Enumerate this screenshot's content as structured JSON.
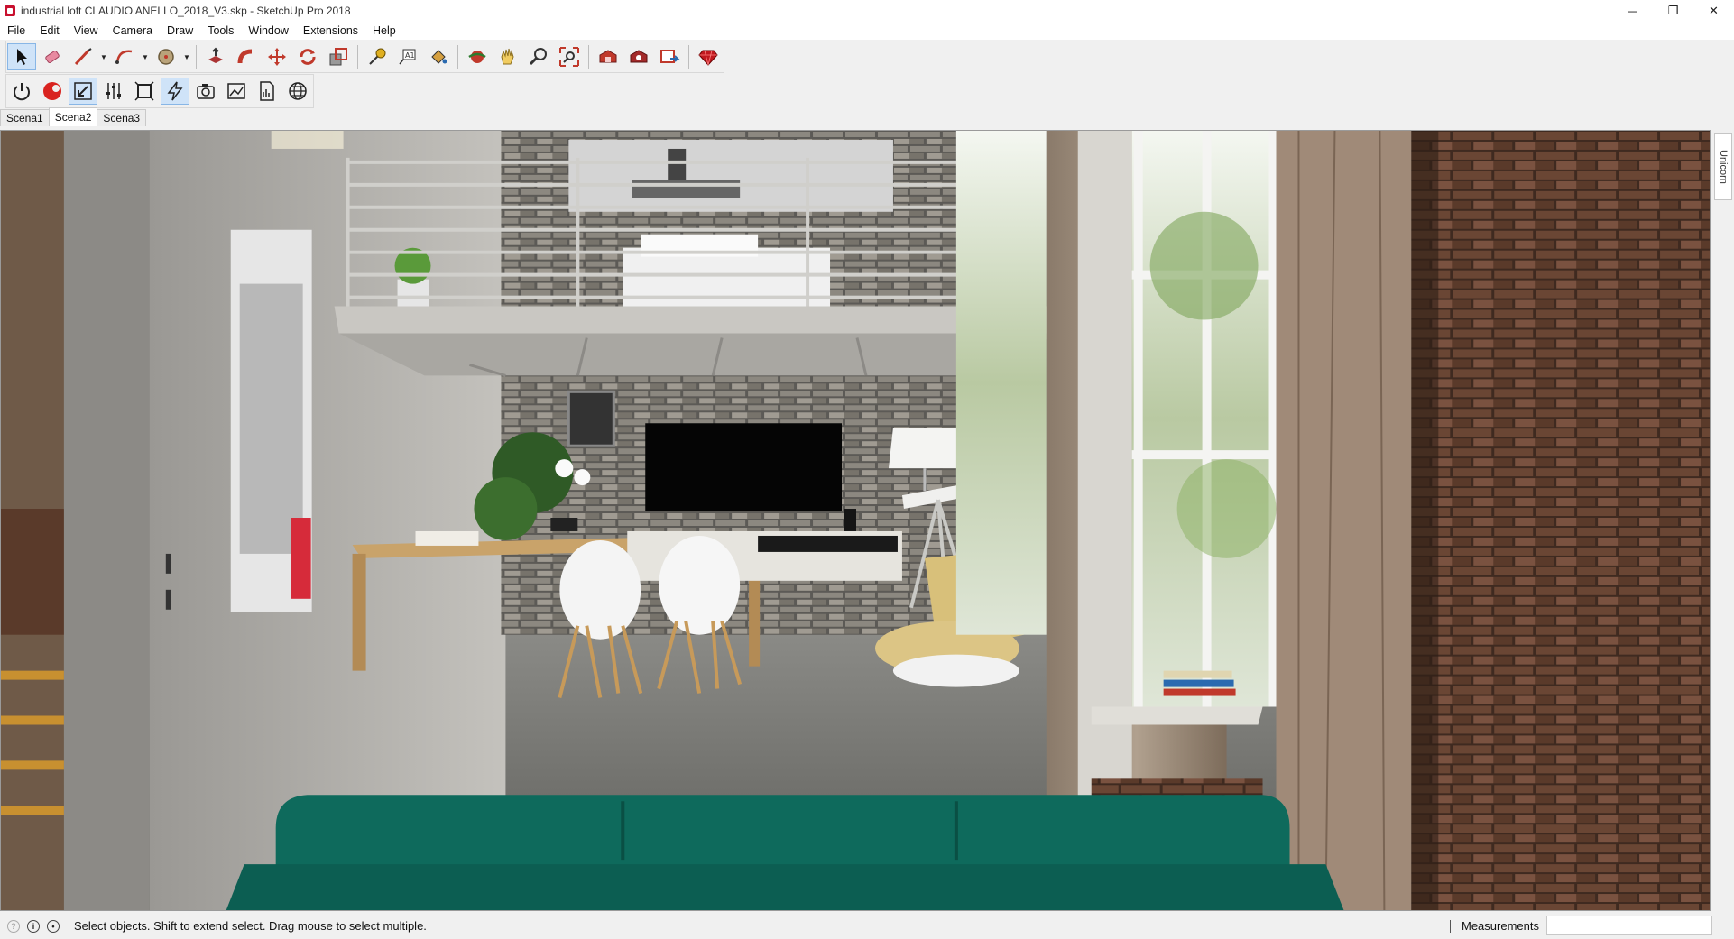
{
  "window": {
    "title": "industrial loft CLAUDIO ANELLO_2018_V3.skp - SketchUp Pro 2018",
    "controls": [
      "─",
      "❐",
      "✕"
    ]
  },
  "menu": [
    "File",
    "Edit",
    "View",
    "Camera",
    "Draw",
    "Tools",
    "Window",
    "Extensions",
    "Help"
  ],
  "toolbar1": {
    "tools": [
      "select-icon",
      "eraser-icon",
      "line-icon",
      "arc-icon",
      "shape-icon",
      "push-pull-icon",
      "follow-me-icon",
      "move-icon",
      "rotate-icon",
      "scale-icon",
      "tape-measure-icon",
      "text-icon",
      "paint-bucket-icon",
      "orbit-icon",
      "pan-icon",
      "zoom-icon",
      "zoom-extents-icon",
      "warehouse-icon",
      "extension-warehouse-icon",
      "layout-icon",
      "ruby-icon"
    ]
  },
  "toolbar2": {
    "tools": [
      "power-icon",
      "render-sphere-icon",
      "resize-icon",
      "sliders-icon",
      "frame-icon",
      "lightning-icon",
      "camera-icon",
      "image-icon",
      "chart-doc-icon",
      "globe-icon"
    ]
  },
  "scenes": [
    "Scena1",
    "Scena2",
    "Scena3"
  ],
  "active_scene": "Scena2",
  "side_tray": {
    "tab_label": "Unicorn"
  },
  "status": {
    "message": "Select objects. Shift to extend select. Drag mouse to select multiple.",
    "measurements_label": "Measurements",
    "measurements_value": ""
  },
  "colors": {
    "sofa": "#0e6a5c",
    "chair": "#d8c07a",
    "brick": "#5a3a2a",
    "tool_active": "#cfe3f8"
  }
}
